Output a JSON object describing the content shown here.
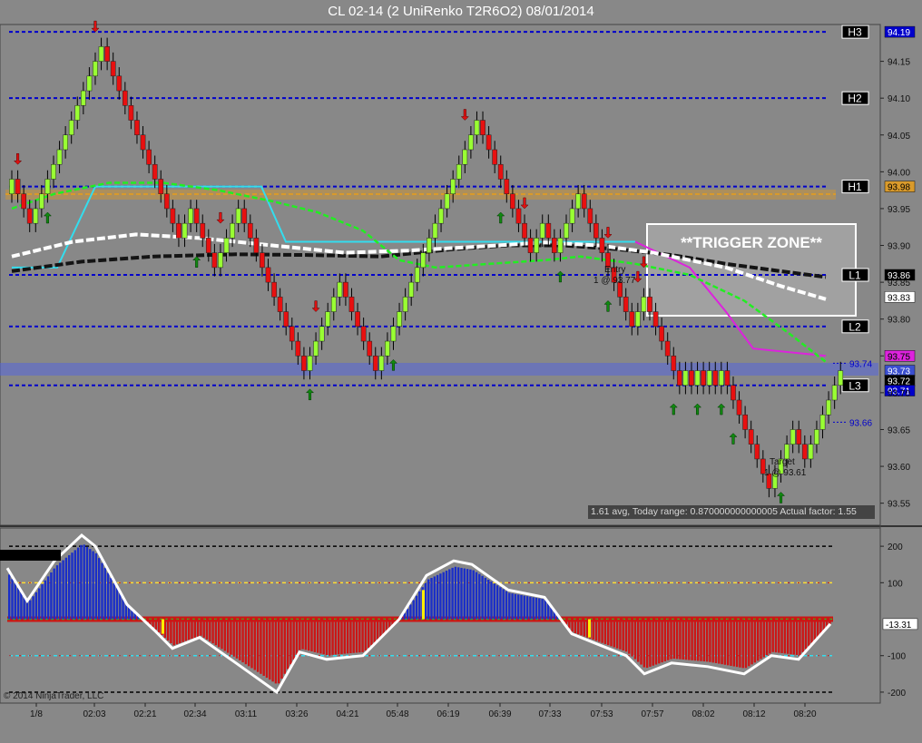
{
  "title": "CL 02-14 (2 UniRenko T2R6O2)  08/01/2014",
  "copyright": "© 2014 NinjaTrader, LLC",
  "trigger_zone_label": "**TRIGGER ZONE**",
  "stats_text": "1.61 avg, Today range: 0.870000000000005  Actual factor: 1.55",
  "annotations": {
    "entry_label": "Entry",
    "entry_price": "1 @ 93.77",
    "target_label": "Target",
    "target_price": "1 @ 93.61"
  },
  "colors": {
    "background": "#888888",
    "up_bar": "#99ff33",
    "down_bar": "#e81010",
    "level_line": "#0000cc",
    "ema_orange": "#d99a2b",
    "ema_green": "#22ee22",
    "ema_white": "#ffffff",
    "ema_black": "#141414",
    "cyan": "#33ddee",
    "magenta": "#dd22dd",
    "histogram_pos": "#1a2ec8",
    "histogram_neg": "#cc1515",
    "cci_line": "#ffffff"
  },
  "chart_data": [
    {
      "type": "candlestick",
      "x_ticks": [
        "1/8",
        "02:03",
        "02:21",
        "02:34",
        "03:11",
        "03:26",
        "04:21",
        "05:48",
        "06:19",
        "06:39",
        "07:33",
        "07:53",
        "07:57",
        "08:02",
        "08:12",
        "08:20"
      ],
      "y_ticks": [
        93.55,
        93.6,
        93.65,
        93.7,
        93.75,
        93.8,
        93.85,
        93.9,
        93.95,
        94.0,
        94.05,
        94.1,
        94.15
      ],
      "ylim": [
        93.52,
        94.2
      ],
      "closes": [
        93.99,
        93.97,
        93.95,
        93.93,
        93.95,
        93.97,
        93.99,
        94.01,
        94.03,
        94.05,
        94.07,
        94.09,
        94.11,
        94.13,
        94.15,
        94.17,
        94.15,
        94.13,
        94.11,
        94.09,
        94.07,
        94.05,
        94.03,
        94.01,
        93.99,
        93.97,
        93.95,
        93.93,
        93.91,
        93.93,
        93.95,
        93.93,
        93.91,
        93.89,
        93.87,
        93.89,
        93.91,
        93.93,
        93.95,
        93.93,
        93.91,
        93.89,
        93.87,
        93.85,
        93.83,
        93.81,
        93.79,
        93.77,
        93.75,
        93.73,
        93.75,
        93.77,
        93.79,
        93.81,
        93.83,
        93.85,
        93.83,
        93.81,
        93.79,
        93.77,
        93.75,
        93.73,
        93.75,
        93.77,
        93.79,
        93.81,
        93.83,
        93.85,
        93.87,
        93.89,
        93.91,
        93.93,
        93.95,
        93.97,
        93.99,
        94.01,
        94.03,
        94.05,
        94.07,
        94.05,
        94.03,
        94.01,
        93.99,
        93.97,
        93.95,
        93.93,
        93.91,
        93.89,
        93.91,
        93.93,
        93.91,
        93.89,
        93.91,
        93.93,
        93.95,
        93.97,
        93.95,
        93.93,
        93.91,
        93.89,
        93.87,
        93.85,
        93.83,
        93.81,
        93.79,
        93.81,
        93.83,
        93.81,
        93.79,
        93.77,
        93.75,
        93.73,
        93.71,
        93.73,
        93.71,
        93.73,
        93.71,
        93.73,
        93.71,
        93.73,
        93.71,
        93.69,
        93.67,
        93.65,
        93.63,
        93.61,
        93.59,
        93.57,
        93.59,
        93.61,
        93.63,
        93.65,
        93.63,
        93.61,
        93.63,
        93.65,
        93.67,
        93.69,
        93.71,
        93.73
      ],
      "levels": [
        {
          "label": "H3",
          "value": 94.19
        },
        {
          "label": "H2",
          "value": 94.1
        },
        {
          "label": "H1",
          "value": 93.98
        },
        {
          "label": "L1",
          "value": 93.86
        },
        {
          "label": "L2",
          "value": 93.79
        },
        {
          "label": "L3",
          "value": 93.71
        }
      ],
      "price_labels": [
        {
          "value": 94.19,
          "text": "94.19",
          "color": "#0000cc"
        },
        {
          "value": 93.98,
          "text": "93.98",
          "color": "#d99a2b"
        },
        {
          "value": 93.86,
          "text": "93.86",
          "color": "#000000"
        },
        {
          "value": 93.83,
          "text": "93.83",
          "color": "#ffffff"
        },
        {
          "value": 93.75,
          "text": "93.75",
          "color": "#dd22dd"
        },
        {
          "value": 93.73,
          "text": "93.73",
          "color": "#3b4fd0"
        },
        {
          "value": 93.72,
          "text": "93.72",
          "color": "#000000"
        },
        {
          "value": 93.71,
          "text": "93.71",
          "color": "#0000cc"
        }
      ],
      "dashed_markers": [
        {
          "value": 93.74,
          "text": "93.74"
        },
        {
          "value": 93.66,
          "text": "93.66"
        }
      ],
      "down_arrows": [
        1,
        14,
        35,
        51,
        76,
        86,
        100,
        105,
        106
      ],
      "up_arrows": [
        6,
        31,
        50,
        64,
        82,
        92,
        100,
        111,
        115,
        119,
        121,
        126,
        129
      ],
      "trigger_zone": {
        "y_top": 93.9,
        "y_bottom": 93.81
      }
    },
    {
      "type": "histogram",
      "name": "CCI",
      "y_ticks": [
        200,
        100,
        -100,
        -200
      ],
      "ylim": [
        -230,
        250
      ],
      "current_value": "-13.31",
      "current": -13.31
    }
  ]
}
